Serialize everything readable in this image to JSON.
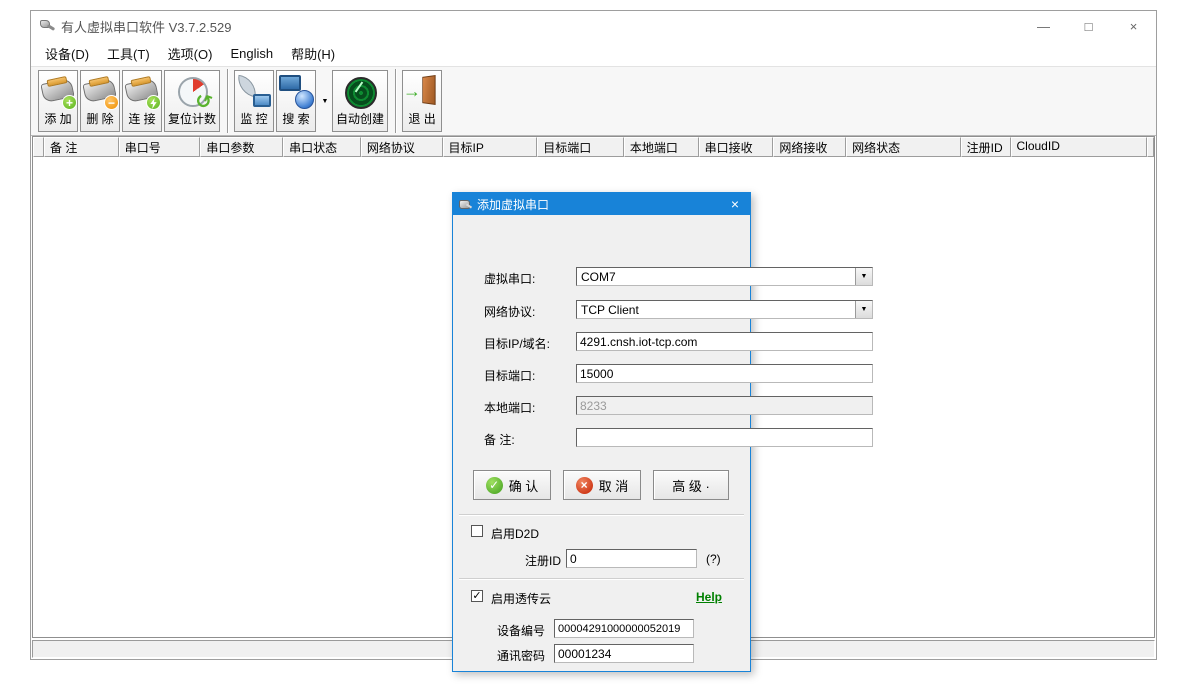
{
  "window": {
    "title": "有人虚拟串口软件 V3.7.2.529",
    "controls": {
      "minimize": "—",
      "maximize": "□",
      "close": "×"
    }
  },
  "menu": {
    "items": [
      "设备(D)",
      "工具(T)",
      "选项(O)",
      "English",
      "帮助(H)"
    ]
  },
  "toolbar": {
    "buttons": [
      {
        "label": "添 加",
        "icon": "serial-port-add"
      },
      {
        "label": "删 除",
        "icon": "serial-port-remove"
      },
      {
        "label": "连 接",
        "icon": "serial-connect"
      },
      {
        "label": "复位计数",
        "icon": "reset-counter"
      },
      {
        "label": "监 控",
        "icon": "monitor"
      },
      {
        "label": "搜 索",
        "icon": "search-network"
      },
      {
        "label": "自动创建",
        "icon": "auto-create-radar"
      },
      {
        "label": "退 出",
        "icon": "exit-door"
      }
    ]
  },
  "table": {
    "columns": [
      "备 注",
      "串口号",
      "串口参数",
      "串口状态",
      "网络协议",
      "目标IP",
      "目标端口",
      "本地端口",
      "串口接收",
      "网络接收",
      "网络状态",
      "注册ID",
      "CloudID"
    ]
  },
  "statusbar": {
    "text": ""
  },
  "dialog": {
    "title": "添加虚拟串口",
    "close": "×",
    "fields": [
      {
        "label": "虚拟串口:",
        "value": "COM7",
        "type": "select"
      },
      {
        "label": "网络协议:",
        "value": "TCP Client",
        "type": "select"
      },
      {
        "label": "目标IP/域名:",
        "value": "4291.cnsh.iot-tcp.com",
        "type": "text"
      },
      {
        "label": "目标端口:",
        "value": "15000",
        "type": "text"
      },
      {
        "label": "本地端口:",
        "value": "8233",
        "type": "text",
        "disabled": true
      },
      {
        "label": "备 注:",
        "value": "",
        "type": "text"
      }
    ],
    "buttons": [
      {
        "label": "确 认",
        "icon": "ok-check"
      },
      {
        "label": "取 消",
        "icon": "cancel-x"
      },
      {
        "label": "高 级 ·",
        "icon": null
      }
    ],
    "d2d": {
      "label": "启用D2D",
      "checked": false,
      "reg_label": "注册ID",
      "reg_value": "0",
      "hint": "(?)"
    },
    "cloud": {
      "label": "启用透传云",
      "checked": true,
      "help_label": "Help",
      "device_label": "设备编号",
      "device_value": "00004291000000052019",
      "pass_label": "通讯密码",
      "pass_value": "00001234"
    }
  },
  "colors": {
    "dialog_titlebar": "#1883d8",
    "help_link_green": "#008000",
    "ok_green": "#3f9e1d",
    "cancel_red": "#c42000"
  }
}
